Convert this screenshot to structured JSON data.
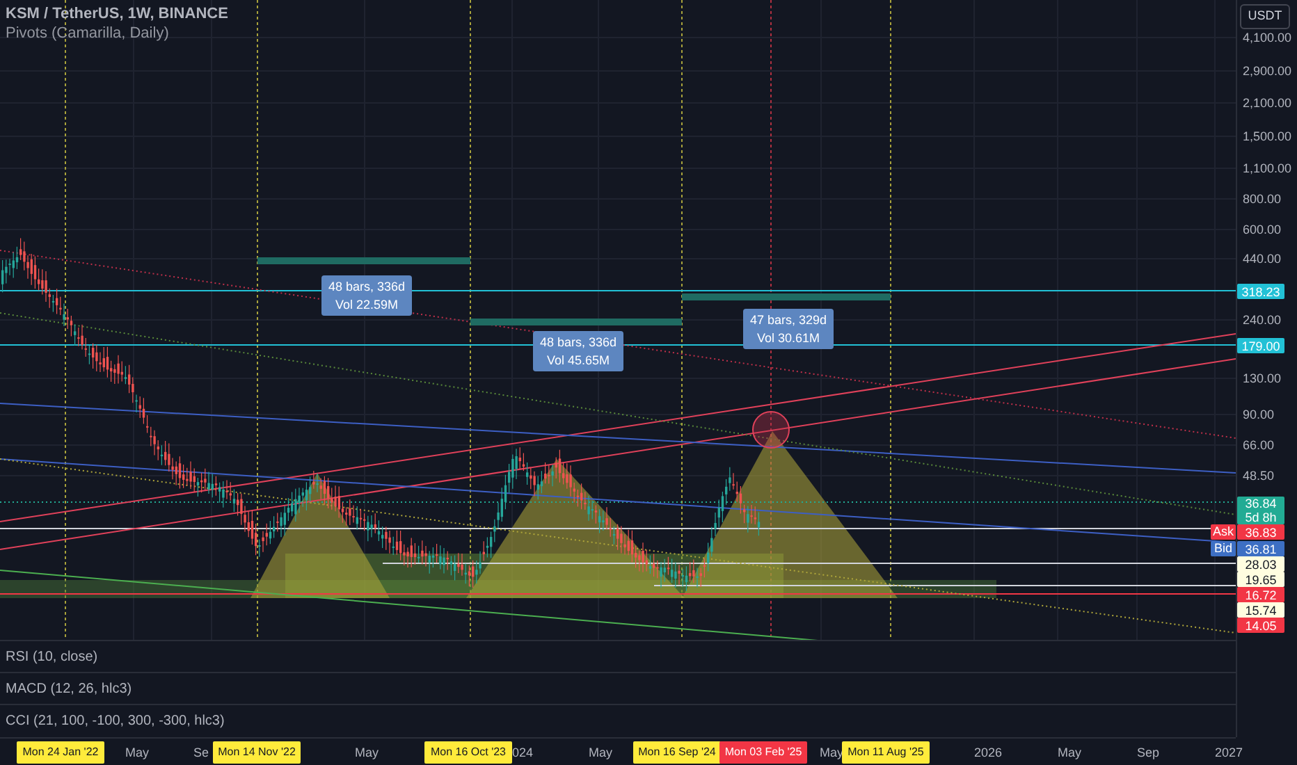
{
  "header": {
    "symbol": "KSM / TetherUS, 1W, BINANCE",
    "indicator": "Pivots (Camarilla, Daily)"
  },
  "measurements": [
    {
      "bars": "48 bars, 336d",
      "volume": "Vol 22.59M"
    },
    {
      "bars": "48 bars, 336d",
      "volume": "Vol 45.65M"
    },
    {
      "bars": "47 bars, 329d",
      "volume": "Vol 30.61M"
    }
  ],
  "indicator_panes": [
    "RSI (10, close)",
    "MACD (12, 26, hlc3)",
    "CCI (21, 100, -100, 300, -300, hlc3)"
  ],
  "price_axis": {
    "unit": "USDT",
    "labels": [
      {
        "text": "4,100.00",
        "kind": "tick"
      },
      {
        "text": "2,900.00",
        "kind": "tick"
      },
      {
        "text": "2,100.00",
        "kind": "tick"
      },
      {
        "text": "1,500.00",
        "kind": "tick"
      },
      {
        "text": "1,100.00",
        "kind": "tick"
      },
      {
        "text": "800.00",
        "kind": "tick"
      },
      {
        "text": "600.00",
        "kind": "tick"
      },
      {
        "text": "440.00",
        "kind": "tick"
      },
      {
        "text": "318.23",
        "kind": "badge",
        "color": "#22c1d6"
      },
      {
        "text": "240.00",
        "kind": "tick"
      },
      {
        "text": "179.00",
        "kind": "badge",
        "color": "#22c1d6"
      },
      {
        "text": "130.00",
        "kind": "tick"
      },
      {
        "text": "90.00",
        "kind": "tick"
      },
      {
        "text": "66.00",
        "kind": "tick"
      },
      {
        "text": "48.50",
        "kind": "tick"
      },
      {
        "text": "36.84",
        "subtext": "5d 8h",
        "kind": "badge",
        "color": "#22ab94"
      },
      {
        "text": "36.83",
        "tag": "Ask",
        "kind": "badge",
        "color": "#f23645"
      },
      {
        "text": "36.81",
        "tag": "Bid",
        "kind": "badge",
        "color": "#3d6fc4"
      },
      {
        "text": "28.03",
        "kind": "badge",
        "color": "#fffde0"
      },
      {
        "text": "19.65",
        "kind": "badge",
        "color": "#fffde0"
      },
      {
        "text": "16.72",
        "kind": "badge",
        "color": "#f23645"
      },
      {
        "text": "15.74",
        "kind": "badge",
        "color": "#fffde0"
      },
      {
        "text": "14.05",
        "kind": "badge",
        "color": "#f23645"
      }
    ]
  },
  "time_axis": [
    {
      "text": "Mon 24 Jan '22",
      "kind": "marker",
      "color": "#ffeb3b"
    },
    {
      "text": "May",
      "kind": "tick"
    },
    {
      "text": "Se",
      "kind": "tick"
    },
    {
      "text": "Mon 14 Nov '22",
      "kind": "marker",
      "color": "#ffeb3b"
    },
    {
      "text": "May",
      "kind": "tick"
    },
    {
      "text": "Mon 16 Oct '23",
      "kind": "marker",
      "color": "#ffeb3b"
    },
    {
      "text": "024",
      "kind": "tick"
    },
    {
      "text": "May",
      "kind": "tick"
    },
    {
      "text": "Mon 16 Sep '24",
      "kind": "marker",
      "color": "#ffeb3b"
    },
    {
      "text": "Mon 03 Feb '25",
      "kind": "marker",
      "color": "#f23645"
    },
    {
      "text": "May",
      "kind": "tick"
    },
    {
      "text": "Mon 11 Aug '25",
      "kind": "marker",
      "color": "#ffeb3b"
    },
    {
      "text": "2026",
      "kind": "tick"
    },
    {
      "text": "May",
      "kind": "tick"
    },
    {
      "text": "Sep",
      "kind": "tick"
    },
    {
      "text": "2027",
      "kind": "tick"
    }
  ]
}
